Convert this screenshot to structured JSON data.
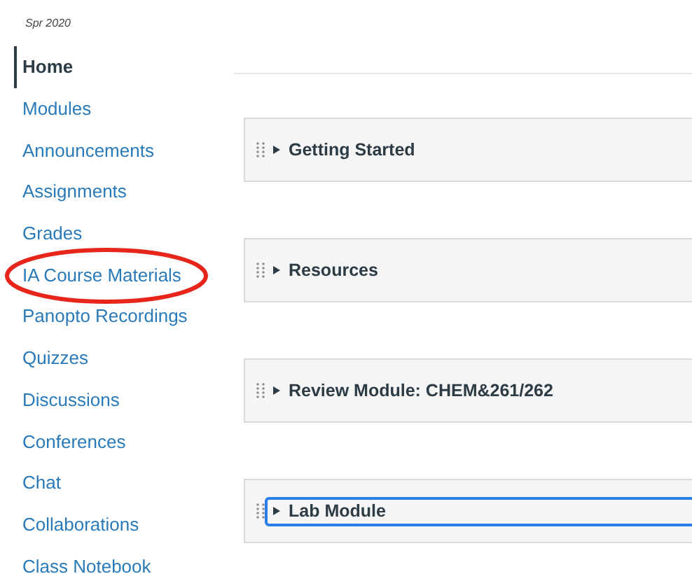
{
  "term": "Spr 2020",
  "nav": [
    {
      "label": "Home",
      "selected": true
    },
    {
      "label": "Modules",
      "selected": false
    },
    {
      "label": "Announcements",
      "selected": false
    },
    {
      "label": "Assignments",
      "selected": false
    },
    {
      "label": "Grades",
      "selected": false
    },
    {
      "label": "IA Course Materials",
      "selected": false,
      "circled": true
    },
    {
      "label": "Panopto Recordings",
      "selected": false
    },
    {
      "label": "Quizzes",
      "selected": false
    },
    {
      "label": "Discussions",
      "selected": false
    },
    {
      "label": "Conferences",
      "selected": false
    },
    {
      "label": "Chat",
      "selected": false
    },
    {
      "label": "Collaborations",
      "selected": false
    },
    {
      "label": "Class Notebook",
      "selected": false
    }
  ],
  "modules": [
    {
      "title": "Getting Started",
      "expanded": false,
      "focused": false
    },
    {
      "title": "Resources",
      "expanded": false,
      "focused": false
    },
    {
      "title": "Review Module: CHEM&261/262",
      "expanded": false,
      "focused": false
    },
    {
      "title": "Lab Module",
      "expanded": false,
      "focused": true
    }
  ]
}
